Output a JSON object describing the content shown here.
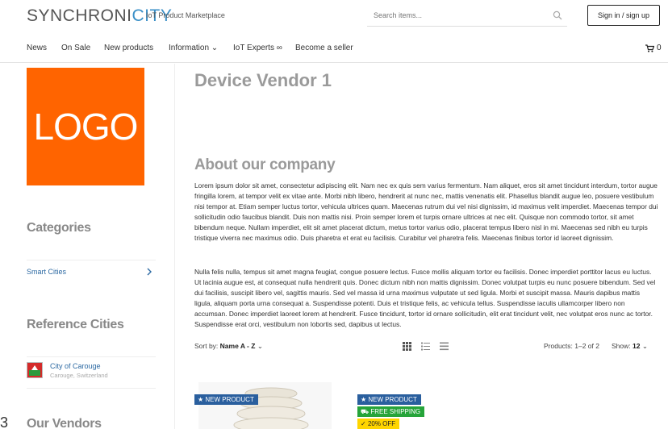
{
  "header": {
    "brand_part1": "SYNCHRONI",
    "brand_part2": "CITY",
    "tagline": "IoT Product Marketplace",
    "search_placeholder": "Search items...",
    "signin_label": "Sign in / sign up"
  },
  "nav": {
    "items": [
      "News",
      "On Sale",
      "New products",
      "Information ⌄",
      "IoT Experts ∞",
      "Become a seller"
    ],
    "cart_count": "0"
  },
  "sidebar": {
    "logo_text": "LOGO",
    "categories_heading": "Categories",
    "category_item": "Smart Cities",
    "reference_heading": "Reference Cities",
    "city_name": "City of Carouge",
    "city_location": "Carouge, Switzerland",
    "vendors_heading": "Our Vendors",
    "edge_char": "3"
  },
  "main": {
    "vendor_title": "Device Vendor 1",
    "about_heading": "About our company",
    "paragraph1": "Lorem ipsum dolor sit amet, consectetur adipiscing elit. Nam nec ex quis sem varius fermentum. Nam aliquet, eros sit amet tincidunt interdum, tortor augue fringilla lorem, at tempor velit ex vitae ante. Morbi nibh libero, hendrerit at nunc nec, mattis venenatis elit. Phasellus blandit augue leo, posuere vestibulum nisi tempor at. Etiam semper luctus tortor, vehicula ultrices quam. Maecenas rutrum dui vel nisi dignissim, id maximus velit imperdiet. Maecenas tempor dui sollicitudin odio faucibus blandit. Duis non mattis nisi. Proin semper lorem et turpis ornare ultrices at nec elit. Quisque non commodo tortor, sit amet bibendum neque. Nullam imperdiet, elit sit amet placerat dictum, metus tortor varius odio, placerat tempus libero nisl in mi. Maecenas sed nibh eu turpis tristique viverra nec maximus odio. Duis pharetra et erat eu facilisis. Curabitur vel pharetra felis. Maecenas finibus tortor id laoreet dignissim.",
    "paragraph2": "Nulla felis nulla, tempus sit amet magna feugiat, congue posuere lectus. Fusce mollis aliquam tortor eu facilisis. Donec imperdiet porttitor lacus eu luctus. Ut lacinia augue est, at consequat nulla hendrerit quis. Donec dictum nibh non mattis dignissim. Donec volutpat turpis eu nunc posuere bibendum. Sed vel dui facilisis, suscipit libero vel, sagittis mauris. Sed vel massa id urna maximus vulputate ut sed ligula. Morbi et suscipit massa. Mauris dapibus mattis ligula, aliquam porta urna consequat a. Suspendisse potenti. Duis et tristique felis, ac vehicula tellus. Suspendisse iaculis ullamcorper libero non accumsan. Donec imperdiet laoreet lorem at hendrerit. Fusce tincidunt, tortor id ornare sollicitudin, elit erat tincidunt velit, nec volutpat eros nunc ac tortor. Suspendisse erat orci, vestibulum non lobortis sed, dapibus ut lectus."
  },
  "toolbar": {
    "sort_label": "Sort by:",
    "sort_value": "Name A - Z",
    "products_count": "Products: 1–2 of 2",
    "show_label": "Show:",
    "show_value": "12"
  },
  "products": {
    "badge_new": "NEW PRODUCT",
    "badge_shipping": "FREE SHIPPING",
    "badge_off": "20% OFF"
  }
}
